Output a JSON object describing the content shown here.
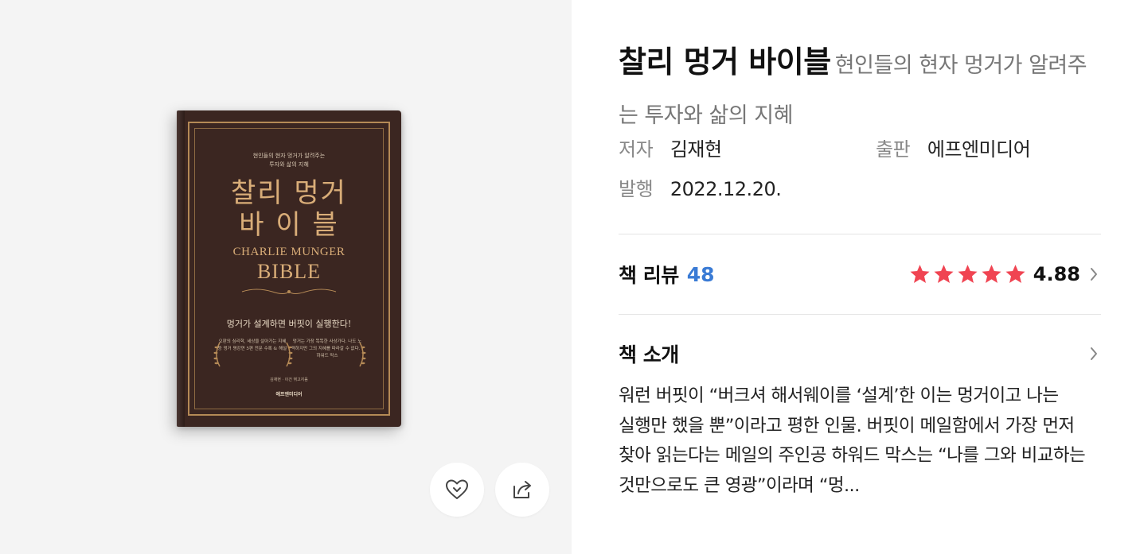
{
  "book": {
    "title": "찰리 멍거 바이블",
    "subtitle": "현인들의 현자 멍거가 알려주는 투자와 삶의 지혜",
    "meta": {
      "author_label": "저자",
      "author": "김재현",
      "publisher_label": "출판",
      "publisher": "에프엔미디어",
      "date_label": "발행",
      "date": "2022.12.20."
    },
    "cover": {
      "subtitle_line1": "현인들의 현자 멍거가 알려주는",
      "subtitle_line2": "투자와 삶의 지혜",
      "title_line1": "찰리 멍거",
      "title_line2": "바 이 블",
      "english_title": "CHARLIE MUNGER",
      "english_bible": "BIBLE",
      "tagline": "멍거가 설계하면 버핏이 실행한다!",
      "blurb_left": "오판의 심리학, 세상을 살아가는 지혜 등 멍거 명강연 5편 전문 수록 & 해설",
      "blurb_right": "멍거는 가장 똑똑한 사상가다. 나도 노력하지만 그의 지혜를 따라갈 수 없다. - 하워드 막스",
      "author_line": "김재현 · 이건 엮고지음",
      "publisher_line": "에프엔미디어"
    }
  },
  "review": {
    "label": "책 리뷰",
    "count": "48",
    "rating": "4.88",
    "stars": 5,
    "star_color": "#f04452"
  },
  "intro": {
    "label": "책 소개",
    "text": "워런 버핏이 “버크셔 해서웨이를 ‘설계’한 이는 멍거이고 나는 실행만 했을 뿐”이라고 평한 인물. 버핏이 메일함에서 가장 먼저 찾아 읽는다는 메일의 주인공 하워드 막스는 “나를 그와 비교하는 것만으로도 큰 영광”이라며 “멍..."
  },
  "icons": {
    "like": "heart-icon",
    "share": "share-icon",
    "chevron": "chevron-right-icon"
  },
  "colors": {
    "accent_blue": "#3a7bd5",
    "star_red": "#f04452",
    "panel_bg": "#f4f4f4",
    "cover_bg": "#3b2621",
    "cover_gold": "#d9ad78"
  }
}
